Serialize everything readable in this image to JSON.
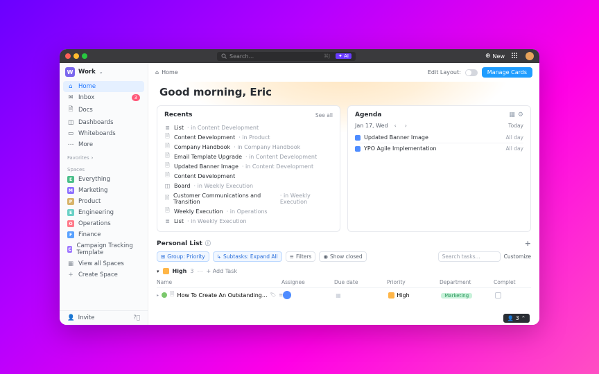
{
  "titlebar": {
    "search_placeholder": "Search...",
    "kbd": "⌘J",
    "ai": "✦ AI",
    "new": "New"
  },
  "workspace": {
    "initial": "W",
    "name": "Work"
  },
  "nav": {
    "home": "Home",
    "inbox": "Inbox",
    "inbox_badge": "3",
    "docs": "Docs",
    "dashboards": "Dashboards",
    "whiteboards": "Whiteboards",
    "more": "More"
  },
  "sections": {
    "favorites": "Favorites",
    "spaces": "Spaces"
  },
  "spaces": [
    {
      "initial": "E",
      "color": "#4abf8a",
      "name": "Everything"
    },
    {
      "initial": "M",
      "color": "#8e72ff",
      "name": "Marketing"
    },
    {
      "initial": "P",
      "color": "#d8b46a",
      "name": "Product"
    },
    {
      "initial": "E",
      "color": "#6ad1c6",
      "name": "Engineering"
    },
    {
      "initial": "O",
      "color": "#ff7a8a",
      "name": "Operations"
    },
    {
      "initial": "F",
      "color": "#5aa2ff",
      "name": "Finance"
    },
    {
      "initial": "C",
      "color": "#a079ff",
      "name": "Campaign Tracking Template"
    }
  ],
  "space_footer": {
    "view_all": "View all Spaces",
    "create": "Create Space"
  },
  "sidebar_footer": {
    "invite": "Invite"
  },
  "breadcrumb": {
    "home": "Home"
  },
  "layout": {
    "edit": "Edit Layout:",
    "manage": "Manage Cards"
  },
  "greeting": "Good morning, Eric",
  "recents": {
    "title": "Recents",
    "see_all": "See all",
    "items": [
      {
        "icon": "list",
        "title": "List",
        "ctx": "· in Content Development"
      },
      {
        "icon": "doc",
        "title": "Content Development",
        "ctx": "· in Product"
      },
      {
        "icon": "doc",
        "title": "Company Handbook",
        "ctx": "· in Company Handbook"
      },
      {
        "icon": "doc",
        "title": "Email Template Upgrade",
        "ctx": "· in Content Development"
      },
      {
        "icon": "doc",
        "title": "Updated Banner Image",
        "ctx": "· in Content Development"
      },
      {
        "icon": "doc",
        "title": "Content Development",
        "ctx": ""
      },
      {
        "icon": "board",
        "title": "Board",
        "ctx": "· in Weekly Execution"
      },
      {
        "icon": "doc",
        "title": "Customer Communications and Transition",
        "ctx": "· in Weekly Execution"
      },
      {
        "icon": "doc",
        "title": "Weekly Execution",
        "ctx": "· in Operations"
      },
      {
        "icon": "list",
        "title": "List",
        "ctx": "· in Weekly Execution"
      }
    ]
  },
  "agenda": {
    "title": "Agenda",
    "date": "Jan 17, Wed",
    "today": "Today",
    "items": [
      {
        "color": "#4e8cff",
        "title": "Updated Banner Image",
        "when": "All day"
      },
      {
        "color": "#4e8cff",
        "title": "YPO Agile Implementation",
        "when": "All day"
      }
    ]
  },
  "personal": {
    "title": "Personal List",
    "chips": {
      "group": "Group: Priority",
      "subtasks": "Subtasks: Expand All",
      "filters": "Filters",
      "show_closed": "Show closed"
    },
    "search_placeholder": "Search tasks...",
    "customize": "Customize",
    "group_row": {
      "label": "High",
      "count": "3",
      "add": "+ Add Task"
    },
    "headers": {
      "name": "Name",
      "assignee": "Assignee",
      "due": "Due date",
      "priority": "Priority",
      "dept": "Department",
      "complete": "Complet"
    },
    "task": {
      "title": "How To Create An Outstanding...",
      "priority": "High",
      "dept": "Marketing"
    }
  },
  "float": {
    "count": "3"
  }
}
